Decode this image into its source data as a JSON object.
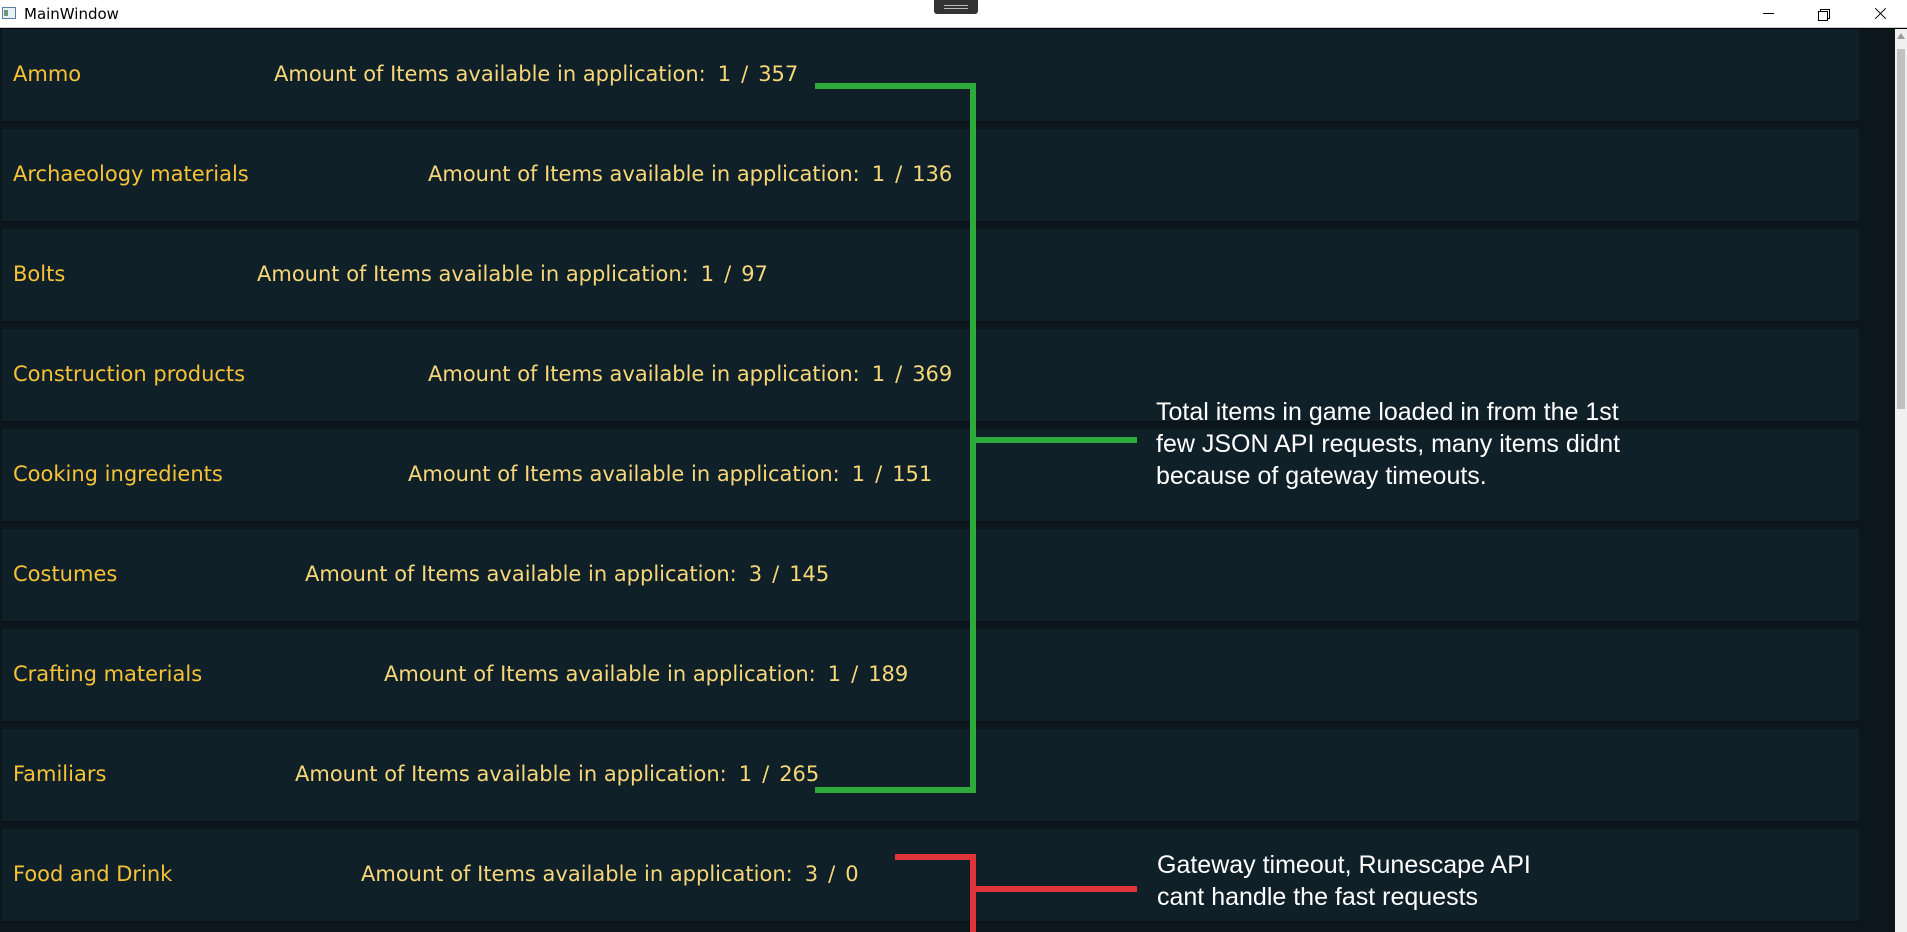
{
  "window": {
    "title": "MainWindow"
  },
  "info_label": "Amount of Items available in application:",
  "separator": "/",
  "rows": [
    {
      "name": "Ammo",
      "loaded": "1",
      "total": "357"
    },
    {
      "name": "Archaeology materials",
      "loaded": "1",
      "total": "136"
    },
    {
      "name": "Bolts",
      "loaded": "1",
      "total": "97"
    },
    {
      "name": "Construction products",
      "loaded": "1",
      "total": "369"
    },
    {
      "name": "Cooking ingredients",
      "loaded": "1",
      "total": "151"
    },
    {
      "name": "Costumes",
      "loaded": "3",
      "total": "145"
    },
    {
      "name": "Crafting materials",
      "loaded": "1",
      "total": "189"
    },
    {
      "name": "Familiars",
      "loaded": "1",
      "total": "265"
    },
    {
      "name": "Food and Drink",
      "loaded": "3",
      "total": "0"
    }
  ],
  "annotations": {
    "success": {
      "lines": [
        "Total items in game loaded in from the 1st",
        "few JSON API requests, many items didnt",
        "because of gateway timeouts."
      ],
      "color": "#2eaa3a"
    },
    "failure": {
      "lines": [
        "Gateway timeout, Runescape API",
        "cant handle the fast requests"
      ],
      "color": "#e0343a"
    }
  },
  "colors": {
    "background": "#102029",
    "category_text": "#f6c236",
    "info_text": "#f7d778"
  }
}
